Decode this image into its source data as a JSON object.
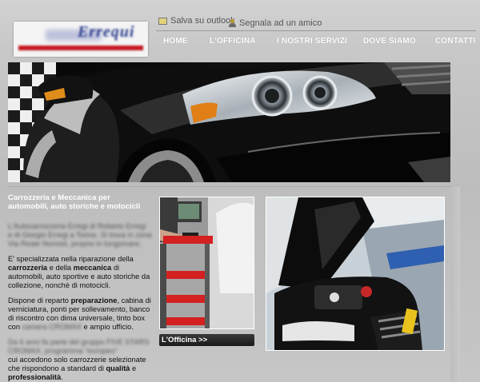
{
  "toolbar": {
    "save_outlook": "Salva su outlook",
    "recommend": "Segnala ad un amico"
  },
  "nav": {
    "items": [
      "HOME",
      "L'OFFICINA",
      "I NOSTRI SERVIZI",
      "DOVE SIAMO",
      "CONTATTI"
    ]
  },
  "logo": {
    "brand": "Errequi"
  },
  "intro": {
    "heading": "Carrozzeria e Meccanica per automobili, auto storiche e motocicli",
    "blurred_para": "L'Autocarrozzeria Erregi di Roberto Erregi e di Giorgio Erregi a Torino. Si trova in zona Via Reale Nomisti, proprio in lungomare.",
    "p2_a": "E' specializzata nella riparazione della ",
    "p2_b": "carrozzeria",
    "p2_c": " e della ",
    "p2_d": "meccanica",
    "p2_e": " di automobili, auto sportive e auto storiche da collezione, nonchè di motocicli.",
    "p3_a": "Dispone di reparto ",
    "p3_b": "preparazione",
    "p3_c": ", cabina di verniciatura, ponti per sollevamento, banco di riscontro con dima universale, tinto box con ",
    "p3_blur": "camera CROMAX",
    "p3_d": " e ampio ufficio.",
    "blurred_para2": "Da 6 anni fa parte del gruppo FIVE STARS CROMAX, programma \"europeo\"",
    "p4_a": "cui accedono solo carrozzerie selezionate che rispondono a standard di ",
    "p4_b": "qualità",
    "p4_c": " e ",
    "p4_d": "professionalità",
    "p4_e": "."
  },
  "photo_caption": "L'Officina >>",
  "colors": {
    "accent_red": "#c5161f",
    "nav_text": "#ffffff",
    "dark": "#1a1a1a"
  }
}
